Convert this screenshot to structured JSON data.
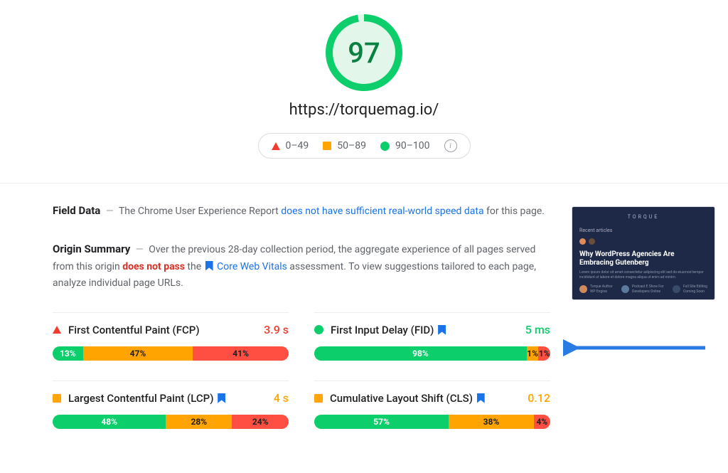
{
  "score": {
    "value": "97"
  },
  "url": "https://torquemag.io/",
  "legend": {
    "poor_range": "0–49",
    "avg_range": "50–89",
    "good_range": "90–100"
  },
  "field_data": {
    "heading": "Field Data",
    "pre_text": "The Chrome User Experience Report ",
    "link_text": "does not have sufficient real-world speed data",
    "post_text": " for this page."
  },
  "origin_summary": {
    "heading": "Origin Summary",
    "pre_text": "Over the previous 28-day collection period, the aggregate experience of all pages served from this origin ",
    "fail_text": "does not pass",
    "mid_text": " the ",
    "cwv_text": "Core Web Vitals",
    "post_text": " assessment. To view suggestions tailored to each page, analyze individual page URLs."
  },
  "metrics": {
    "fcp": {
      "name": "First Contentful Paint (FCP)",
      "value": "3.9 s",
      "segments": {
        "good": "13%",
        "avg": "47%",
        "poor": "41%"
      },
      "widths": {
        "good": 13,
        "avg": 47,
        "poor": 41
      }
    },
    "fid": {
      "name": "First Input Delay (FID)",
      "value": "5 ms",
      "segments": {
        "good": "98%",
        "avg": "1%",
        "poor": "1%"
      },
      "widths": {
        "good": 90,
        "avg": 5,
        "poor": 5
      }
    },
    "lcp": {
      "name": "Largest Contentful Paint (LCP)",
      "value": "4 s",
      "segments": {
        "good": "48%",
        "avg": "28%",
        "poor": "24%"
      },
      "widths": {
        "good": 48,
        "avg": 28,
        "poor": 24
      }
    },
    "cls": {
      "name": "Cumulative Layout Shift (CLS)",
      "value": "0.12",
      "segments": {
        "good": "57%",
        "avg": "38%",
        "poor": "4%"
      },
      "widths": {
        "good": 57,
        "avg": 36,
        "poor": 7
      }
    }
  },
  "thumbnail": {
    "logo": "TORQUE",
    "recent": "Recent articles",
    "headline": "Why WordPress Agencies Are Embracing Gutenberg"
  }
}
